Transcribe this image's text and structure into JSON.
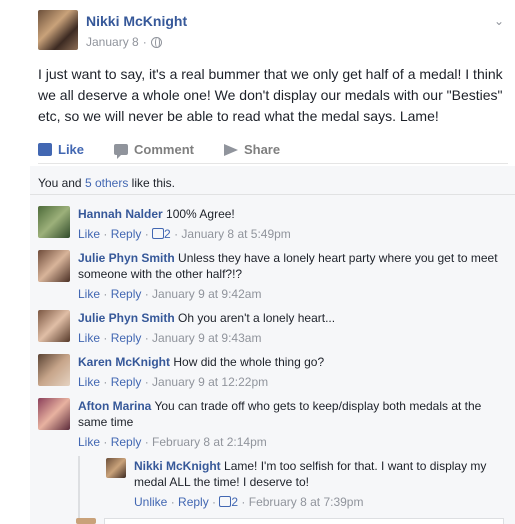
{
  "post": {
    "author": "Nikki McKnight",
    "date": "January 8",
    "separator": " · ",
    "text": "I just want to say, it's a real bummer that we only get half of a medal! I think we all deserve a whole one! We don't display our medals with our \"Besties\" etc, so we will never be able to read what the medal says. Lame!",
    "actions": {
      "like": "Like",
      "comment": "Comment",
      "share": "Share"
    }
  },
  "likes_summary": {
    "prefix": "You and ",
    "others": "5 others",
    "suffix": " like this."
  },
  "comments": [
    {
      "name": "Hannah Nalder",
      "text": "100% Agree!",
      "like": "Like",
      "reply": "Reply",
      "likes": "2",
      "time": "January 8 at 5:49pm"
    },
    {
      "name": "Julie Phyn Smith",
      "text": "Unless they have a lonely heart party where you get to meet someone with the other half?!?",
      "like": "Like",
      "reply": "Reply",
      "time": "January 9 at 9:42am"
    },
    {
      "name": "Julie Phyn Smith",
      "text": "Oh you aren't a lonely heart...",
      "like": "Like",
      "reply": "Reply",
      "time": "January 9 at 9:43am"
    },
    {
      "name": "Karen McKnight",
      "text": "How did the whole thing go?",
      "like": "Like",
      "reply": "Reply",
      "time": "January 9 at 12:22pm"
    },
    {
      "name": "Afton Marina",
      "text": "You can trade off who gets to keep/display both medals at the same time",
      "like": "Like",
      "reply": "Reply",
      "time": "February 8 at 2:14pm"
    }
  ],
  "reply": {
    "name": "Nikki McKnight",
    "text": "Lame! I'm too selfish for that. I want to display my medal ALL the time! I deserve to!",
    "unlike": "Unlike",
    "reply": "Reply",
    "likes": "2",
    "time": "February 8 at 7:39pm"
  },
  "sep": " · ",
  "colors": {
    "link": "#365899",
    "accent": "#4267b2",
    "muted": "#90949c"
  }
}
